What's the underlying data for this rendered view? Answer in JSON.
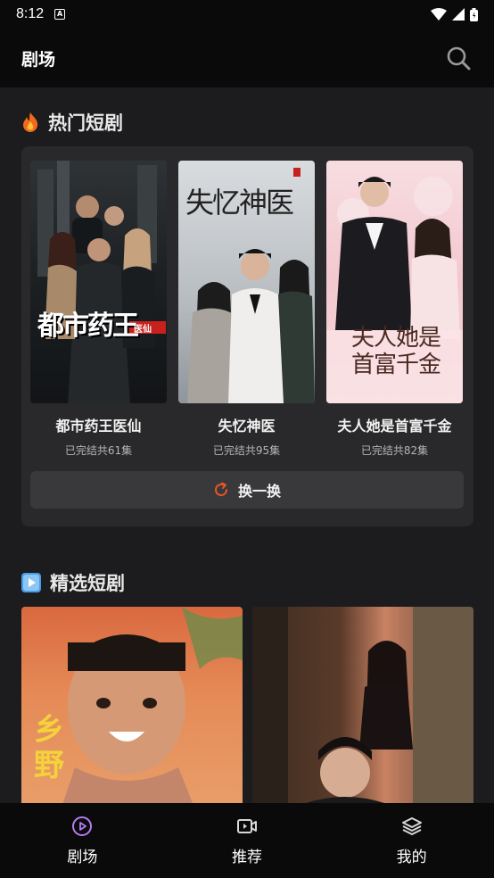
{
  "status_bar": {
    "time": "8:12",
    "notif_letter": "A"
  },
  "header": {
    "title": "剧场"
  },
  "hot_section": {
    "title": "热门短剧",
    "items": [
      {
        "title": "都市药王医仙",
        "subtitle": "已完结共61集",
        "poster_text": "都市药王",
        "poster_tag": "医仙"
      },
      {
        "title": "失忆神医",
        "subtitle": "已完结共95集",
        "poster_text": "失忆神医"
      },
      {
        "title": "夫人她是首富千金",
        "subtitle": "已完结共82集",
        "poster_text": "夫人她是首富千金"
      }
    ],
    "refresh_label": "换一换"
  },
  "featured_section": {
    "title": "精选短剧",
    "items": [
      {
        "poster_text": "乡野"
      },
      {
        "poster_text": ""
      }
    ]
  },
  "tab_bar": {
    "tabs": [
      {
        "label": "剧场",
        "icon": "play-circle-icon"
      },
      {
        "label": "推荐",
        "icon": "video-icon"
      },
      {
        "label": "我的",
        "icon": "layers-icon"
      }
    ]
  },
  "colors": {
    "accent": "#e8542a",
    "background": "#1c1c1e",
    "panel": "#29292b",
    "bar": "#0a0a0a"
  }
}
